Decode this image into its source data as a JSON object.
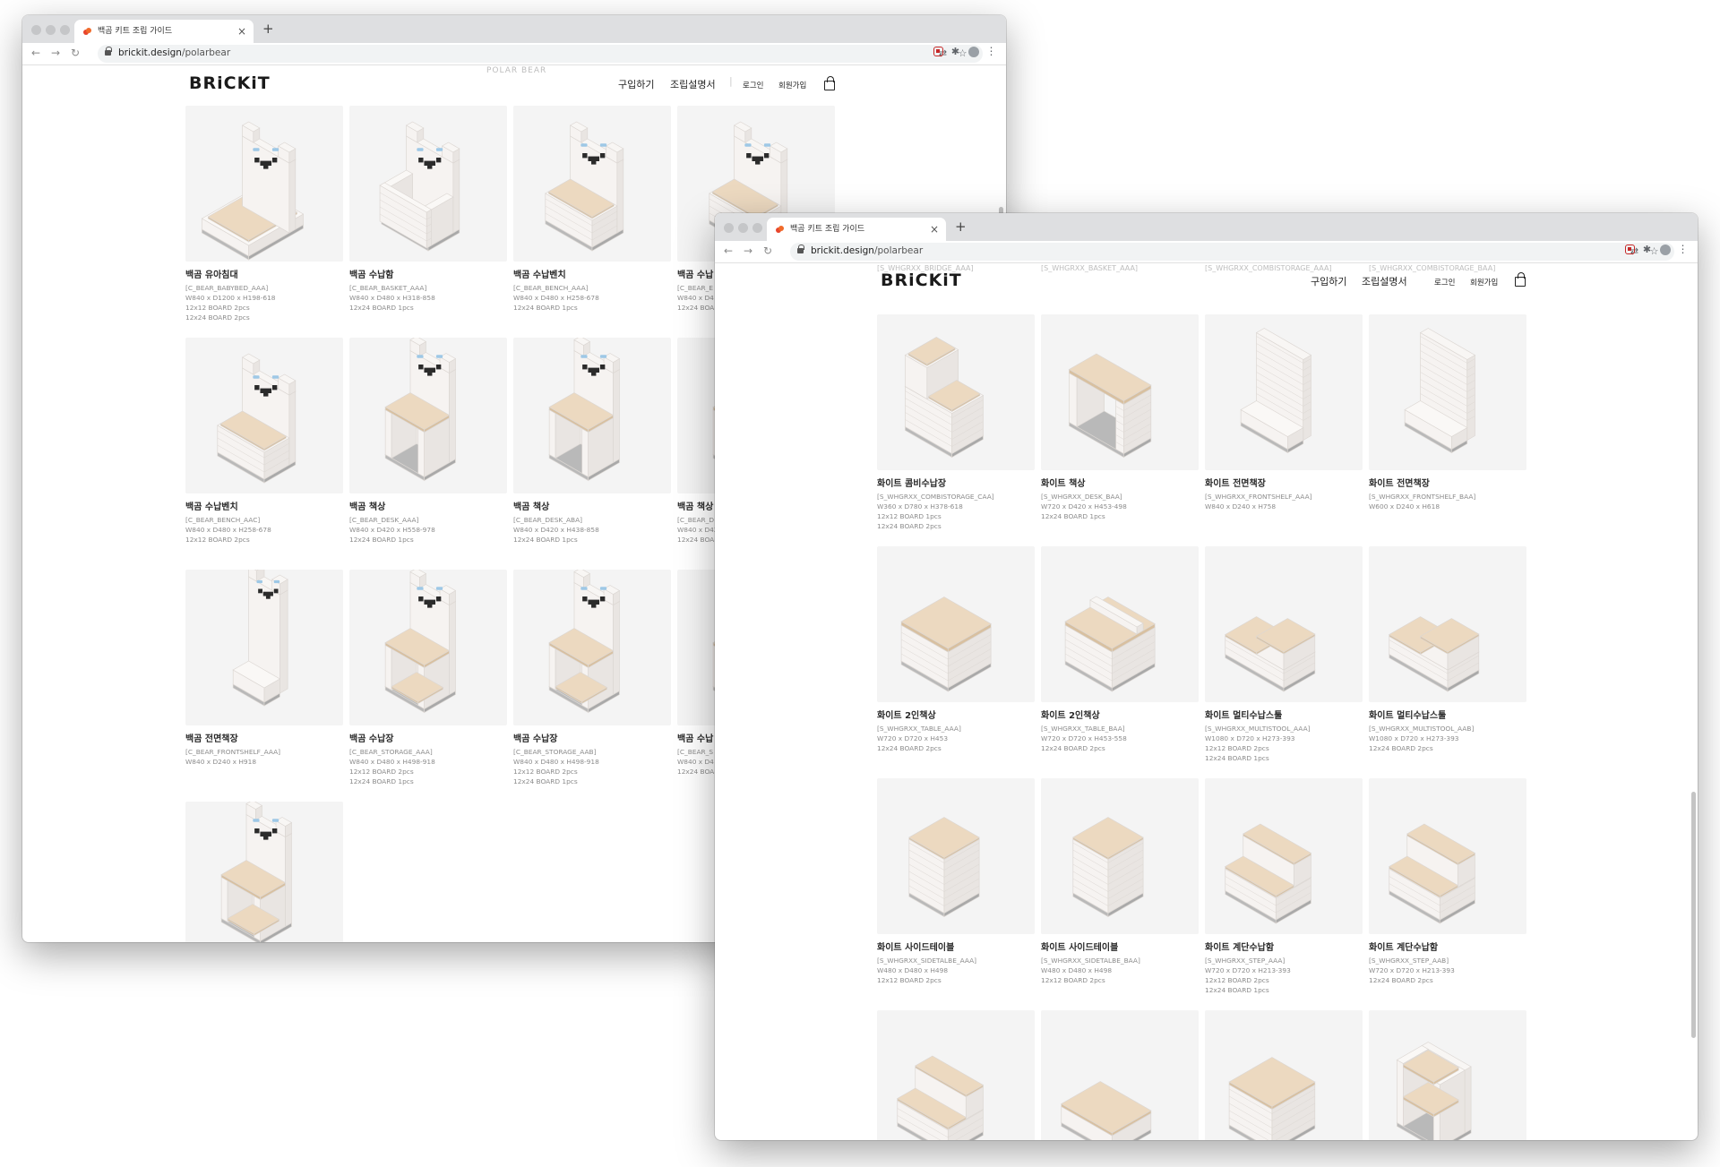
{
  "back_window": {
    "tab_title": "백곰 키트 조립 가이드",
    "url_host": "brickit.design",
    "url_path": "/polarbear",
    "site": {
      "logo": "BRiCKiT",
      "nav": [
        "구입하기",
        "조립설명서"
      ],
      "login": "로그인",
      "signup": "회원가입",
      "faded_heading": "POLAR BEAR"
    },
    "products": [
      {
        "name": "백곰 유아침대",
        "lines": [
          "[C_BEAR_BABYBED_AAA]",
          "W840 x D1200 x H198-618",
          "12x12 BOARD 2pcs",
          "12x24 BOARD 2pcs"
        ],
        "shape": "bed"
      },
      {
        "name": "백곰 수납함",
        "lines": [
          "[C_BEAR_BASKET_AAA]",
          "W840 x D480 x H318-858",
          "12x24 BOARD 1pcs"
        ],
        "shape": "basket"
      },
      {
        "name": "백곰 수납벤치",
        "lines": [
          "[C_BEAR_BENCH_AAA]",
          "W840 x D480 x H258-678",
          "12x24 BOARD 1pcs"
        ],
        "shape": "bench"
      },
      {
        "name": "백곰 수납",
        "lines": [
          "[C_BEAR_E",
          "W840 x D4",
          "12x24 BOAR"
        ],
        "shape": "bench"
      },
      {
        "name": "백곰 수납벤치",
        "lines": [
          "[C_BEAR_BENCH_AAC]",
          "W840 x D480 x H258-678",
          "12x12 BOARD 2pcs"
        ],
        "shape": "bench2"
      },
      {
        "name": "백곰 책상",
        "lines": [
          "[C_BEAR_DESK_AAA]",
          "W840 x D420 x H558-978",
          "12x24 BOARD 1pcs"
        ],
        "shape": "desk"
      },
      {
        "name": "백곰 책상",
        "lines": [
          "[C_BEAR_DESK_ABA]",
          "W840 x D420 x H438-858",
          "12x24 BOARD 1pcs"
        ],
        "shape": "desk"
      },
      {
        "name": "백곰 책상",
        "lines": [
          "[C_BEAR_D",
          "W840 x D42",
          "12x24 BOAR"
        ],
        "shape": "desk"
      },
      {
        "name": "백곰 전면책장",
        "lines": [
          "[C_BEAR_FRONTSHELF_AAA]",
          "W840 x D240 x H918"
        ],
        "shape": "front"
      },
      {
        "name": "백곰 수납장",
        "lines": [
          "[C_BEAR_STORAGE_AAA]",
          "W840 x D480 x H498-918",
          "12x12 BOARD 2pcs",
          "12x24 BOARD 1pcs"
        ],
        "shape": "storage"
      },
      {
        "name": "백곰 수납장",
        "lines": [
          "[C_BEAR_STORAGE_AAB]",
          "W840 x D480 x H498-918",
          "12x12 BOARD 2pcs",
          "12x24 BOARD 1pcs"
        ],
        "shape": "storage"
      },
      {
        "name": "백곰 수납",
        "lines": [
          "[C_BEAR_S",
          "W840 x D4",
          "12x24 BOAR"
        ],
        "shape": "storage"
      },
      {
        "name": "",
        "lines": [],
        "shape": "storage"
      }
    ]
  },
  "front_window": {
    "tab_title": "백곰 키트 조립 가이드",
    "url_host": "brickit.design",
    "url_path": "/polarbear",
    "site": {
      "logo": "BRiCKiT",
      "nav": [
        "구입하기",
        "조립설명서"
      ],
      "login": "로그인",
      "signup": "회원가입"
    },
    "faded_rows": [
      [
        "[S_WHGRXX_BRIDGE_AAA]",
        "[S_WHGRXX_BASKET_AAA]",
        "[S_WHGRXX_COMBISTORAGE_AAA]",
        "[S_WHGRXX_COMBISTORAGE_BAA]"
      ]
    ],
    "products": [
      {
        "name": "화이트 콤비수납장",
        "lines": [
          "[S_WHGRXX_COMBISTORAGE_CAA]",
          "W360 x D780 x H378-618",
          "12x12 BOARD 1pcs",
          "12x24 BOARD 2pcs"
        ],
        "shape": "combi"
      },
      {
        "name": "화이트 책상",
        "lines": [
          "[S_WHGRXX_DESK_BAA]",
          "W720 x D420 x H453-498",
          "12x24 BOARD 1pcs"
        ],
        "shape": "wdesk"
      },
      {
        "name": "화이트 전면책장",
        "lines": [
          "[S_WHGRXX_FRONTSHELF_AAA]",
          "W840 x D240 x H758"
        ],
        "shape": "wfront"
      },
      {
        "name": "화이트 전면책장",
        "lines": [
          "[S_WHGRXX_FRONTSHELF_BAA]",
          "W600 x D240 x H618"
        ],
        "shape": "wfront2"
      },
      {
        "name": "화이트 2인책상",
        "lines": [
          "[S_WHGRXX_TABLE_AAA]",
          "W720 x D720 x H453",
          "12x24 BOARD 2pcs"
        ],
        "shape": "table"
      },
      {
        "name": "화이트 2인책상",
        "lines": [
          "[S_WHGRXX_TABLE_BAA]",
          "W720 x D720 x H453-558",
          "12x24 BOARD 2pcs"
        ],
        "shape": "table2"
      },
      {
        "name": "화이트 멀티수납스툴",
        "lines": [
          "[S_WHGRXX_MULTISTOOL_AAA]",
          "W1080 x D720 x H273-393",
          "12x12 BOARD 2pcs",
          "12x24 BOARD 1pcs"
        ],
        "shape": "multi"
      },
      {
        "name": "화이트 멀티수납스툴",
        "lines": [
          "[S_WHGRXX_MULTISTOOL_AAB]",
          "W1080 x D720 x H273-393",
          "12x24 BOARD 2pcs"
        ],
        "shape": "multi"
      },
      {
        "name": "화이트 사이드테이블",
        "lines": [
          "[S_WHGRXX_SIDETALBE_AAA]",
          "W480 x D480 x H498",
          "12x12 BOARD 2pcs"
        ],
        "shape": "side"
      },
      {
        "name": "화이트 사이드테이블",
        "lines": [
          "[S_WHGRXX_SIDETALBE_BAA]",
          "W480 x D480 x H498",
          "12x12 BOARD 2pcs"
        ],
        "shape": "side2"
      },
      {
        "name": "화이트 계단수납함",
        "lines": [
          "[S_WHGRXX_STEP_AAA]",
          "W720 x D720 x H213-393",
          "12x12 BOARD 2pcs",
          "12x24 BOARD 1pcs"
        ],
        "shape": "step"
      },
      {
        "name": "화이트 계단수납함",
        "lines": [
          "[S_WHGRXX_STEP_AAB]",
          "W720 x D720 x H213-393",
          "12x24 BOARD 2pcs"
        ],
        "shape": "step"
      },
      {
        "name": "",
        "lines": [],
        "shape": "step"
      },
      {
        "name": "",
        "lines": [],
        "shape": "flat"
      },
      {
        "name": "",
        "lines": [],
        "shape": "cube"
      },
      {
        "name": "",
        "lines": [],
        "shape": "shelf"
      }
    ]
  },
  "colors": {
    "wood": "#ecd9c0",
    "wood_edge": "#d8c0a0",
    "brick": "#f6f3f1",
    "brick_line": "#dcd7d3",
    "base": "#b9b9b9",
    "card_bg": "#f4f4f4",
    "bear_black": "#2b2b2b",
    "bear_blue": "#9ec8e6"
  }
}
